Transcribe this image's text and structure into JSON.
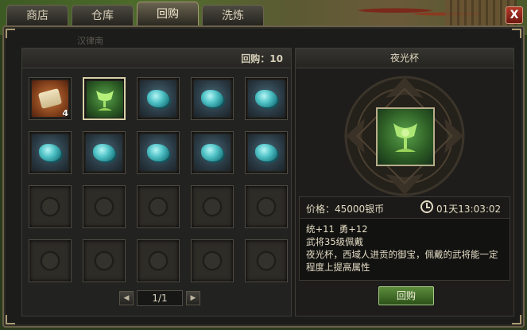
{
  "tabs": [
    {
      "label": "商店",
      "active": false
    },
    {
      "label": "仓库",
      "active": false
    },
    {
      "label": "回购",
      "active": true
    },
    {
      "label": "洗炼",
      "active": false
    }
  ],
  "close_label": "X",
  "watermark": "汉律南",
  "buyback_count_text": "回购：10",
  "inventory": {
    "slots": [
      {
        "item": "scroll",
        "qty": "4",
        "selected": false
      },
      {
        "item": "jade-cup",
        "qty": "",
        "selected": true
      },
      {
        "item": "cyan-ore",
        "qty": "",
        "selected": false
      },
      {
        "item": "cyan-ore",
        "qty": "",
        "selected": false
      },
      {
        "item": "cyan-ore",
        "qty": "",
        "selected": false
      },
      {
        "item": "cyan-ore",
        "qty": "",
        "selected": false
      },
      {
        "item": "cyan-ore",
        "qty": "",
        "selected": false
      },
      {
        "item": "cyan-ore",
        "qty": "",
        "selected": false
      },
      {
        "item": "cyan-ore",
        "qty": "",
        "selected": false
      },
      {
        "item": "cyan-ore",
        "qty": "",
        "selected": false
      },
      {
        "item": "",
        "qty": "",
        "selected": false
      },
      {
        "item": "",
        "qty": "",
        "selected": false
      },
      {
        "item": "",
        "qty": "",
        "selected": false
      },
      {
        "item": "",
        "qty": "",
        "selected": false
      },
      {
        "item": "",
        "qty": "",
        "selected": false
      },
      {
        "item": "",
        "qty": "",
        "selected": false
      },
      {
        "item": "",
        "qty": "",
        "selected": false
      },
      {
        "item": "",
        "qty": "",
        "selected": false
      },
      {
        "item": "",
        "qty": "",
        "selected": false
      },
      {
        "item": "",
        "qty": "",
        "selected": false
      }
    ]
  },
  "pager": {
    "prev_icon": "triangle-left-icon",
    "next_icon": "triangle-right-icon",
    "display": "1/1"
  },
  "detail": {
    "title": "夜光杯",
    "price_label": "价格：",
    "price_value": "45000银币",
    "time_value": "01天13:03:02",
    "stat_1": "统+11",
    "stat_2": "勇+12",
    "requirement": "武将35级佩戴",
    "description": "夜光杯，西域人进贡的御宝，佩戴的武将能一定程度上提高属性",
    "button_label": "回购"
  }
}
